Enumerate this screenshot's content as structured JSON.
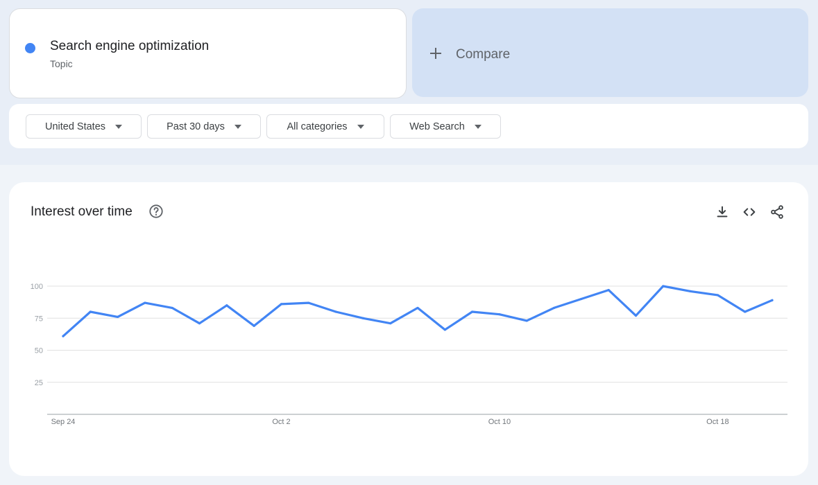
{
  "search_term": {
    "name": "Search engine optimization",
    "type": "Topic",
    "color": "#4285f4"
  },
  "compare": {
    "label": "Compare"
  },
  "filters": {
    "region": "United States",
    "time_range": "Past 30 days",
    "category": "All categories",
    "search_type": "Web Search"
  },
  "panel": {
    "title": "Interest over time",
    "icons": [
      "help-icon",
      "download-icon",
      "embed-code-icon",
      "share-icon"
    ]
  },
  "chart_data": {
    "type": "line",
    "title": "",
    "xlabel": "",
    "ylabel": "",
    "ylim": [
      0,
      100
    ],
    "yticks": [
      25,
      50,
      75,
      100
    ],
    "x_ticks": [
      {
        "label": "Sep 24",
        "index": 0
      },
      {
        "label": "Oct 2",
        "index": 8
      },
      {
        "label": "Oct 10",
        "index": 16
      },
      {
        "label": "Oct 18",
        "index": 24
      }
    ],
    "grid": true,
    "series": [
      {
        "color": "#4285f4",
        "values": [
          61,
          80,
          76,
          87,
          83,
          71,
          85,
          69,
          86,
          87,
          80,
          75,
          71,
          83,
          66,
          80,
          78,
          73,
          83,
          90,
          97,
          77,
          100,
          96,
          93,
          80,
          89
        ]
      }
    ]
  }
}
